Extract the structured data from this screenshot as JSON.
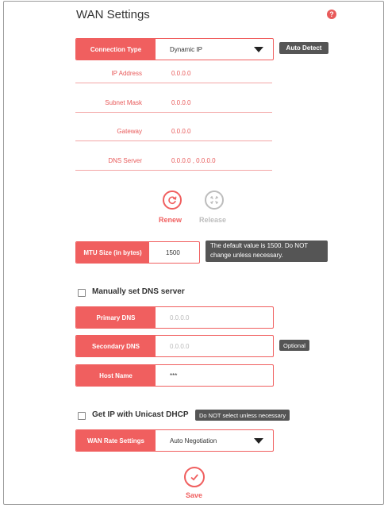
{
  "header": {
    "title": "WAN Settings",
    "help": "?"
  },
  "connection_type": {
    "label": "Connection Type",
    "value": "Dynamic IP",
    "auto_detect": "Auto Detect"
  },
  "info": {
    "ip_address": {
      "label": "IP Address",
      "value": "0.0.0.0"
    },
    "subnet_mask": {
      "label": "Subnet Mask",
      "value": "0.0.0.0"
    },
    "gateway": {
      "label": "Gateway",
      "value": "0.0.0.0"
    },
    "dns_server": {
      "label": "DNS Server",
      "value": "0.0.0.0 , 0.0.0.0"
    }
  },
  "actions": {
    "renew": "Renew",
    "release": "Release"
  },
  "mtu": {
    "label": "MTU Size (in bytes)",
    "value": "1500",
    "note": "The default value is 1500. Do NOT change unless necessary."
  },
  "manual_dns": {
    "label": "Manually set DNS server",
    "primary": {
      "label": "Primary DNS",
      "placeholder": "0.0.0.0"
    },
    "secondary": {
      "label": "Secondary DNS",
      "placeholder": "0.0.0.0",
      "tag": "Optional"
    },
    "host": {
      "label": "Host Name",
      "value": "***"
    }
  },
  "unicast": {
    "label": "Get IP with Unicast DHCP",
    "note": "Do NOT select unless necessary"
  },
  "wan_rate": {
    "label": "WAN Rate Settings",
    "value": "Auto Negotiation"
  },
  "save": {
    "label": "Save"
  },
  "colors": {
    "accent": "#f05f5f",
    "badge": "#555555",
    "muted": "#bdbdbd"
  }
}
